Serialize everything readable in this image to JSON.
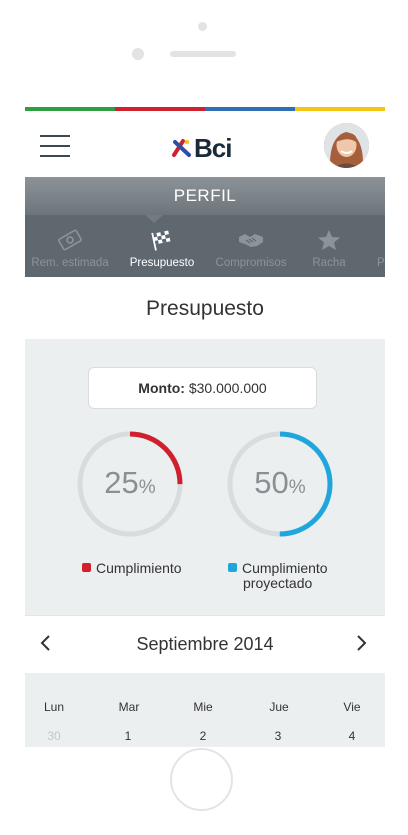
{
  "brand": {
    "name": "Bci",
    "colors": [
      "#2e9e3e",
      "#d0202e",
      "#2f6fb5",
      "#f3c614"
    ]
  },
  "header": {
    "menu_icon": "hamburger-icon",
    "avatar_icon": "user-avatar"
  },
  "profile": {
    "band_label": "PERFIL"
  },
  "tabs": [
    {
      "label": "Rem. estimada",
      "icon": "money-icon",
      "active": false
    },
    {
      "label": "Presupuesto",
      "icon": "checkered-flag-icon",
      "active": true
    },
    {
      "label": "Compromisos",
      "icon": "handshake-icon",
      "active": false
    },
    {
      "label": "Racha",
      "icon": "star-icon",
      "active": false
    },
    {
      "label": "P",
      "icon": "",
      "active": false
    }
  ],
  "page": {
    "title": "Presupuesto"
  },
  "monto": {
    "label": "Monto:",
    "value": "$30.000.000"
  },
  "gauges": [
    {
      "value": "25",
      "unit": "%",
      "percent": 25,
      "color": "#d0202e",
      "legend": "Cumplimiento"
    },
    {
      "value": "50",
      "unit": "%",
      "percent": 50,
      "color": "#1fa6dc",
      "legend_line1": "Cumplimiento",
      "legend_line2": "proyectado"
    }
  ],
  "calendar": {
    "month": "Septiembre 2014",
    "prev_icon": "chevron-left-icon",
    "next_icon": "chevron-right-icon",
    "weekdays": [
      "Lun",
      "Mar",
      "Mie",
      "Jue",
      "Vie"
    ],
    "first_row": [
      "30",
      "1",
      "2",
      "3",
      "4"
    ]
  }
}
